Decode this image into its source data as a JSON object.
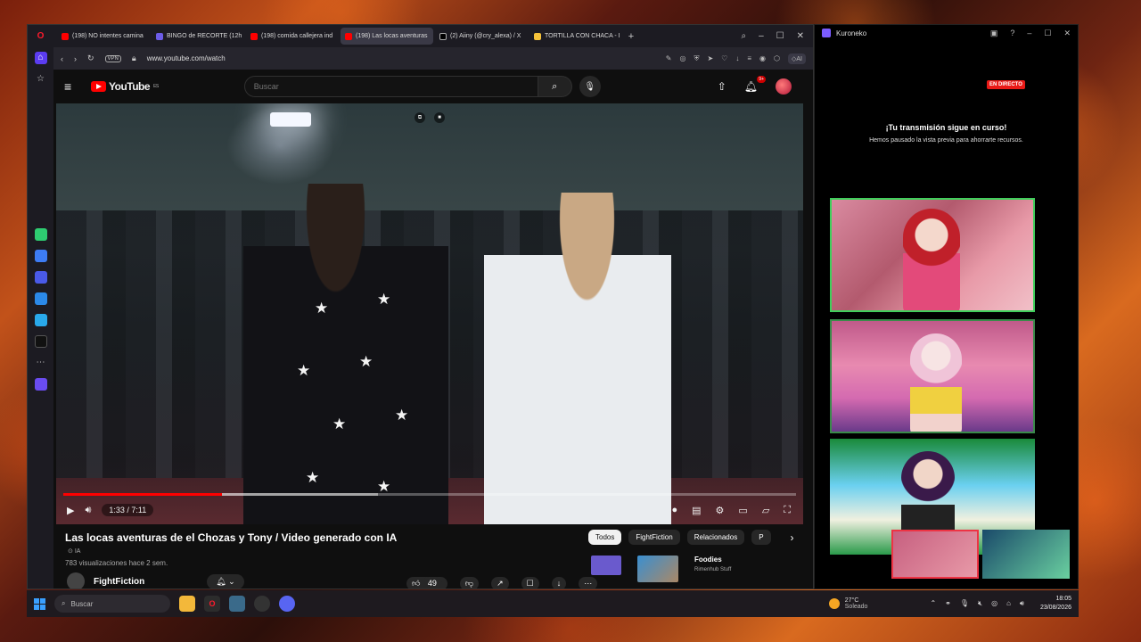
{
  "browser": {
    "tabs": [
      {
        "label": "(198) NO intentes camina",
        "favicon": "youtube-icon"
      },
      {
        "label": "BINGO de RECORTE (12h",
        "favicon": "bingo-icon"
      },
      {
        "label": "(198) comida callejera ind",
        "favicon": "youtube-icon"
      },
      {
        "label": "(198) Las locas aventuras",
        "favicon": "youtube-icon",
        "active": true
      },
      {
        "label": "(2) Aiiny (@cry_alexa) / X",
        "favicon": "x-icon"
      },
      {
        "label": "TORTILLA CON CHACA - I",
        "favicon": "tortilla-icon"
      }
    ],
    "url": "www.youtube.com/watch",
    "vpn_label": "VPN",
    "ai_label": "AI"
  },
  "youtube": {
    "logo_text": "YouTube",
    "logo_region": "ES",
    "search": {
      "placeholder": "Buscar"
    },
    "notifications_count": "9+",
    "player": {
      "current_time": "1:33",
      "duration": "7:11",
      "time_display": "1:33 / 7:11",
      "played_fraction": 0.216,
      "buffered_fraction": 0.43
    },
    "video": {
      "title": "Las locas aventuras de el Chozas y Tony / Video generado con IA",
      "ia_label": "IA",
      "meta": "783 visualizaciones  hace 2 sem.",
      "channel": "FightFiction",
      "likes": "49"
    },
    "chips": [
      "Todos",
      "FightFiction",
      "Relacionados",
      "P"
    ],
    "recommended": {
      "title": "Foodies",
      "subtitle": "Rimenhub Stuff"
    }
  },
  "kuroneko": {
    "window_title": "Kuroneko",
    "live_badge": "EN DIRECTO",
    "message_title": "¡Tu transmisión sigue en curso!",
    "message_body": "Hemos pausado la vista previa para ahorrarte recursos."
  },
  "taskbar": {
    "search_placeholder": "Buscar",
    "weather_temp": "27°C",
    "weather_desc": "Soleado",
    "time": "18:05",
    "date": "23/08/2026"
  },
  "colors": {
    "youtube_red": "#ff0000",
    "live_red": "#e91916",
    "tile_border_green": "#3fcf5b",
    "opera_accent": "#5b3cf0"
  }
}
